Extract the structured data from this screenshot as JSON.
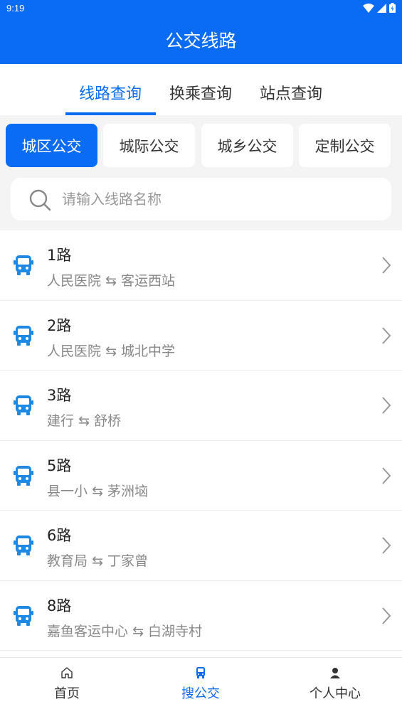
{
  "status": {
    "time": "9:19"
  },
  "header": {
    "title": "公交线路"
  },
  "tabs": [
    {
      "label": "线路查询"
    },
    {
      "label": "换乘查询"
    },
    {
      "label": "站点查询"
    }
  ],
  "categories": [
    {
      "label": "城区公交"
    },
    {
      "label": "城际公交"
    },
    {
      "label": "城乡公交"
    },
    {
      "label": "定制公交"
    }
  ],
  "search": {
    "placeholder": "请输入线路名称"
  },
  "routes": [
    {
      "name": "1路",
      "from": "人民医院",
      "to": "客运西站"
    },
    {
      "name": "2路",
      "from": "人民医院",
      "to": "城北中学"
    },
    {
      "name": "3路",
      "from": "建行",
      "to": "舒桥"
    },
    {
      "name": "5路",
      "from": "县一小",
      "to": "茅洲垴"
    },
    {
      "name": "6路",
      "from": "教育局",
      "to": "丁家曾"
    },
    {
      "name": "8路",
      "from": "嘉鱼客运中心",
      "to": "白湖寺村"
    }
  ],
  "route_separator": "⇆",
  "nav": [
    {
      "label": "首页",
      "icon": "home-icon"
    },
    {
      "label": "搜公交",
      "icon": "bus-icon"
    },
    {
      "label": "个人中心",
      "icon": "user-icon"
    }
  ],
  "colors": {
    "accent": "#0a6cf5",
    "bus_icon": "#1e88e5"
  }
}
